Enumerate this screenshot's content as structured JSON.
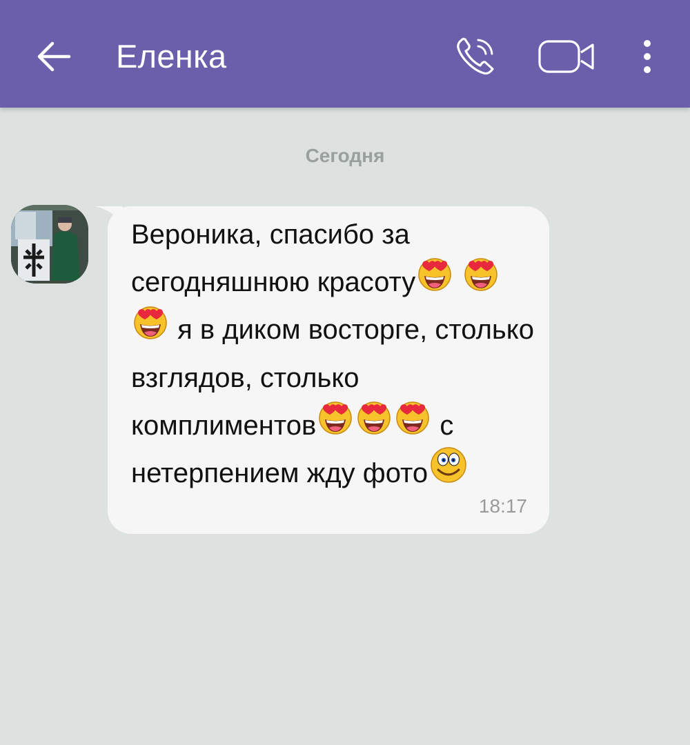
{
  "header": {
    "contact_name": "Еленка",
    "back_icon": "arrow-left-icon",
    "call_icon": "phone-icon",
    "video_icon": "video-camera-icon",
    "menu_icon": "more-vertical-icon",
    "background_color": "#6b5fab"
  },
  "chat": {
    "date_separator": "Сегодня",
    "background_color": "#dde1df",
    "message": {
      "segments": [
        {
          "type": "text",
          "value": "Вероника, спасибо за сегодняшнюю красоту"
        },
        {
          "type": "emoji",
          "name": "heart-eyes-emoji"
        },
        {
          "type": "text",
          "value": " "
        },
        {
          "type": "emoji",
          "name": "heart-eyes-emoji"
        },
        {
          "type": "text",
          "value": " "
        },
        {
          "type": "emoji",
          "name": "heart-eyes-emoji"
        },
        {
          "type": "text",
          "value": " я в диком восторге, столько взглядов,  столько комплиментов"
        },
        {
          "type": "emoji",
          "name": "heart-eyes-emoji"
        },
        {
          "type": "emoji",
          "name": "heart-eyes-emoji"
        },
        {
          "type": "emoji",
          "name": "heart-eyes-emoji"
        },
        {
          "type": "text",
          "value": " с нетерпением жду фото"
        },
        {
          "type": "emoji",
          "name": "wide-eyed-smile-emoji"
        }
      ],
      "time": "18:17",
      "avatar_icon": "contact-avatar"
    }
  }
}
